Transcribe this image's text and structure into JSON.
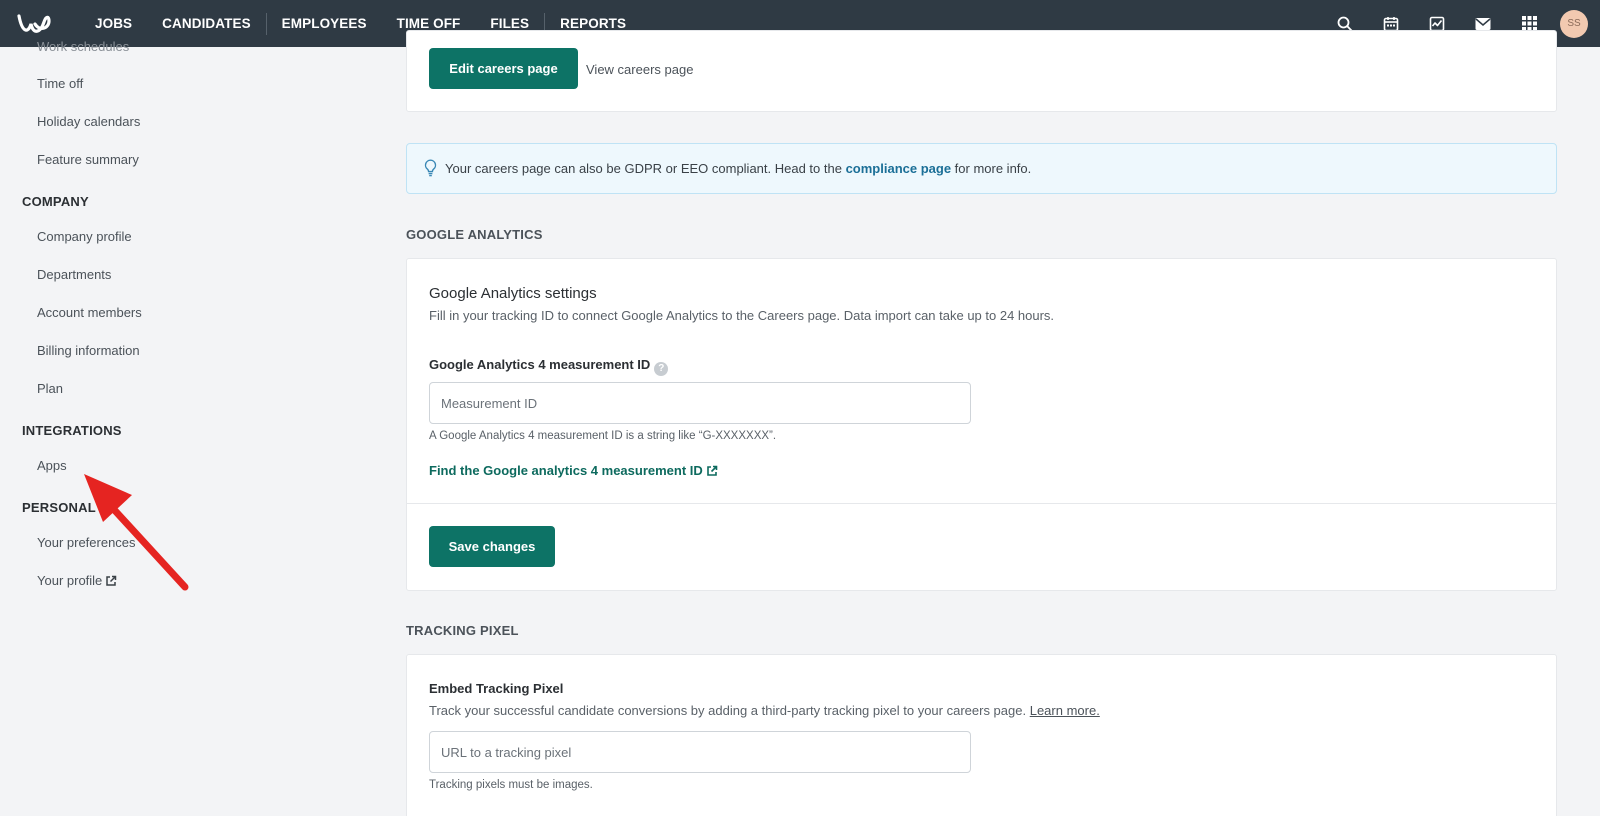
{
  "nav": {
    "items": [
      "JOBS",
      "CANDIDATES",
      "EMPLOYEES",
      "TIME OFF",
      "FILES",
      "REPORTS"
    ],
    "avatar_initials": "SS",
    "bg_color": "#2f3a44"
  },
  "sidebar": {
    "partial_item": "Work schedules",
    "items_top": [
      "Time off",
      "Holiday calendars",
      "Feature summary"
    ],
    "company_heading": "COMPANY",
    "company_items": [
      "Company profile",
      "Departments",
      "Account members",
      "Billing information",
      "Plan"
    ],
    "integrations_heading": "INTEGRATIONS",
    "integrations_items": [
      "Apps"
    ],
    "personal_heading": "PERSONAL",
    "personal_items": [
      "Your preferences",
      "Your profile"
    ]
  },
  "careers": {
    "edit_button": "Edit careers page",
    "view_link": "View careers page"
  },
  "info": {
    "text_before": "Your careers page can also be GDPR or EEO compliant. Head to the ",
    "link": "compliance page",
    "text_after": " for more info."
  },
  "google_analytics": {
    "section_title": "GOOGLE ANALYTICS",
    "card_title": "Google Analytics settings",
    "card_subtitle": "Fill in your tracking ID to connect Google Analytics to the Careers page. Data import can take up to 24 hours.",
    "field_label": "Google Analytics 4 measurement ID",
    "input_placeholder": "Measurement ID",
    "input_value": "",
    "hint": "A Google Analytics 4 measurement ID is a string like “G-XXXXXXX”.",
    "find_link": "Find the Google analytics 4 measurement ID",
    "save_button": "Save changes"
  },
  "tracking_pixel": {
    "section_title": "TRACKING PIXEL",
    "card_title": "Embed Tracking Pixel",
    "card_subtitle": "Track your successful candidate conversions by adding a third-party tracking pixel to your careers page. ",
    "learn_more": "Learn more.",
    "input_placeholder": "URL to a tracking pixel",
    "input_value": "",
    "hint": "Tracking pixels must be images."
  },
  "colors": {
    "primary": "#0d7366",
    "info_bg": "#eef8fd",
    "annotation_arrow": "#e52421"
  }
}
